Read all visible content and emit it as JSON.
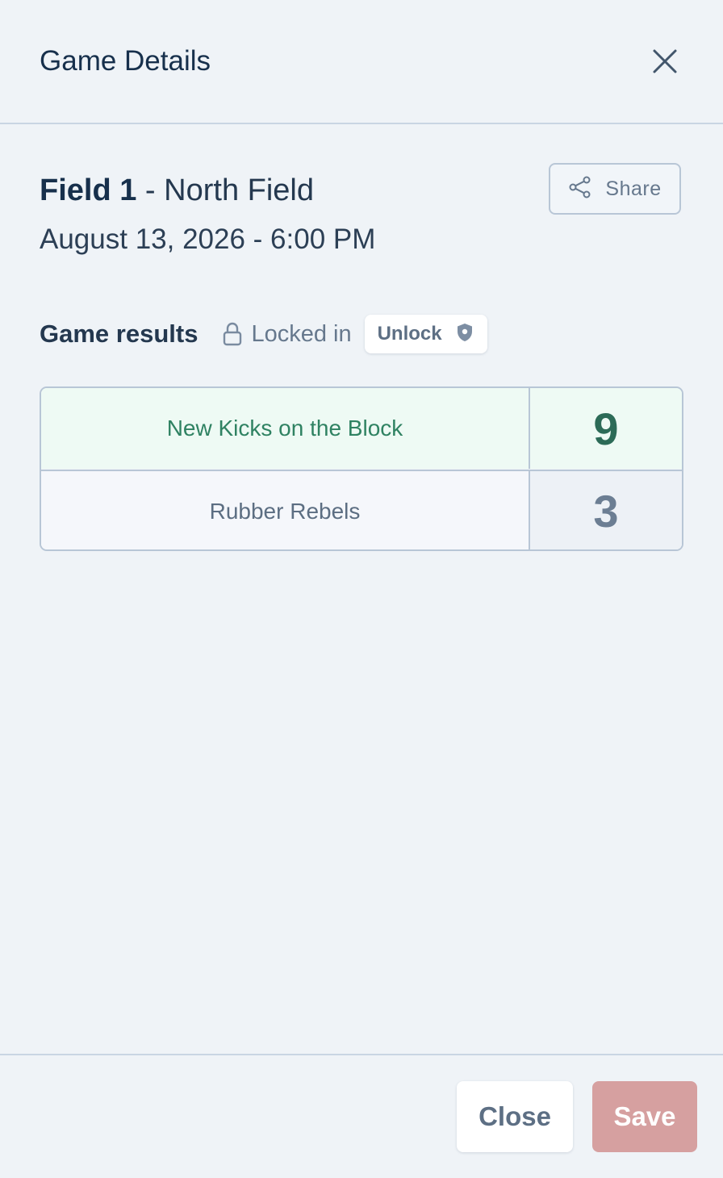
{
  "header": {
    "title": "Game Details"
  },
  "game": {
    "field": "Field 1",
    "separator": " - ",
    "location": "North Field",
    "datetime": "August 13, 2026 - 6:00 PM"
  },
  "share": {
    "label": "Share",
    "icon": "share-icon"
  },
  "results": {
    "title": "Game results",
    "lock_status": "Locked in",
    "lock_icon": "lock-icon",
    "unlock_label": "Unlock",
    "unlock_icon": "shield-icon",
    "rows": [
      {
        "team": "New Kicks on the Block",
        "score": "9",
        "winner": true
      },
      {
        "team": "Rubber Rebels",
        "score": "3",
        "winner": false
      }
    ]
  },
  "footer": {
    "close_label": "Close",
    "save_label": "Save"
  },
  "colors": {
    "background": "#eff3f7",
    "winner_bg": "#eefaf4",
    "winner_text": "#2f8262",
    "save_button": "#d6a0a0"
  }
}
